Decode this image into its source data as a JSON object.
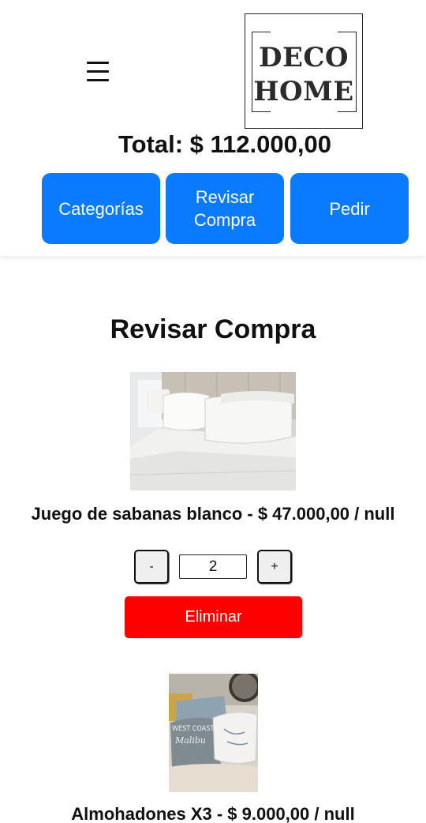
{
  "header": {
    "logo_text": "DECO HOME",
    "total": "Total: $ 112.000,00",
    "nav": [
      {
        "label": "Categorías"
      },
      {
        "label": "Revisar Compra"
      },
      {
        "label": "Pedir"
      }
    ]
  },
  "main": {
    "title": "Revisar Compra",
    "items": [
      {
        "name": "Juego de sabanas blanco - $ 47.000,00 / null",
        "quantity": "2",
        "minus_label": "-",
        "plus_label": "+",
        "delete_label": "Eliminar"
      },
      {
        "name": "Almohadones X3 - $ 9.000,00 / null"
      }
    ]
  },
  "colors": {
    "primary": "#0a7bff",
    "danger": "#ff0000"
  }
}
